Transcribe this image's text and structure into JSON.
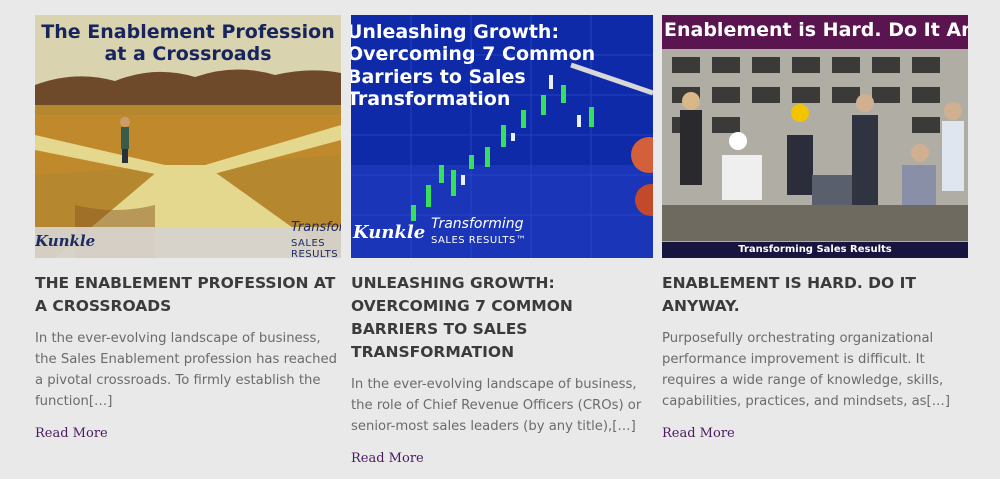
{
  "posts": [
    {
      "image_title": "The Enablement Profession at a Crossroads",
      "image_brand_script": "Kunkle",
      "image_brand_italic": "Transforming",
      "image_brand_caps": "SALES RESULTS",
      "title": "The Enablement Profession at a Crossroads",
      "excerpt": "In the ever-evolving landscape of business, the Sales Enablement profession has reached a pivotal crossroads. To firmly establish the function[…]",
      "read_more": "Read More"
    },
    {
      "image_title": "Unleashing Growth: Overcoming 7 Common Barriers to Sales Transformation",
      "image_brand_script": "Kunkle",
      "image_brand_italic": "Transforming",
      "image_brand_caps": "SALES RESULTS™",
      "title": "Unleashing Growth: Overcoming 7 Common Barriers to Sales Transformation",
      "excerpt": "In the ever-evolving landscape of business, the role of Chief Revenue Officers (CROs) or senior-most sales leaders (by any title),[…]",
      "read_more": "Read More"
    },
    {
      "image_title": "Enablement is Hard. Do It Anyway.",
      "image_banner": "Transforming Sales Results",
      "title": "Enablement is Hard. Do It Anyway.",
      "excerpt": "Purposefully orchestrating organizational performance improvement is difficult. It requires a wide range of knowledge, skills, capabilities, practices, and mindsets, as[…]",
      "read_more": "Read More"
    }
  ],
  "colors": {
    "page_bg": "#e9e9e9",
    "title_text": "#3b3b3b",
    "excerpt_text": "#6b6b6b",
    "link": "#4b1a5e",
    "card3_banner": "#5a1450"
  }
}
